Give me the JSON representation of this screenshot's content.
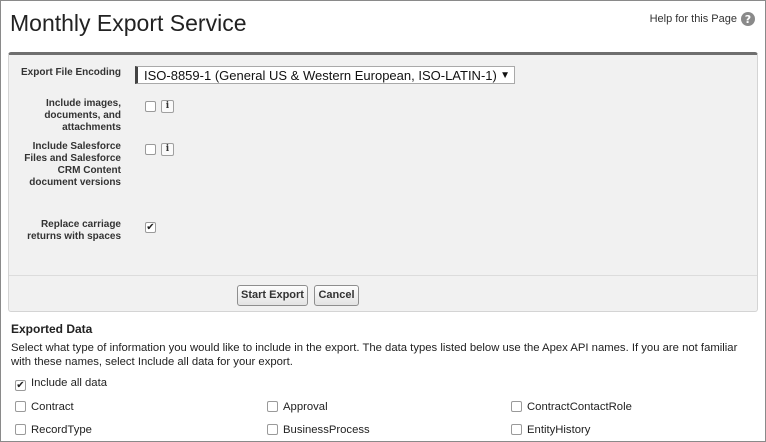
{
  "page": {
    "title": "Monthly Export Service",
    "help_label": "Help for this Page",
    "help_icon": "?"
  },
  "form": {
    "encoding_label": "Export File Encoding",
    "encoding_value": "ISO-8859-1 (General US & Western European, ISO-LATIN-1)",
    "include_images_label": "Include images, documents, and attachments",
    "include_images_checked": false,
    "include_files_label": "Include Salesforce Files and Salesforce CRM Content document versions",
    "include_files_checked": false,
    "replace_cr_label": "Replace carriage returns with spaces",
    "replace_cr_checked": true,
    "info_glyph": "i"
  },
  "buttons": {
    "start_export": "Start Export",
    "cancel": "Cancel"
  },
  "exported_data": {
    "title": "Exported Data",
    "description": "Select what type of information you would like to include in the export. The data types listed below use the Apex API names. If you are not familiar with these names, select Include all data for your export.",
    "include_all_label": "Include all data",
    "include_all_checked": true,
    "objects": [
      {
        "name": "Contract",
        "checked": false
      },
      {
        "name": "Approval",
        "checked": false
      },
      {
        "name": "ContractContactRole",
        "checked": false
      },
      {
        "name": "RecordType",
        "checked": false
      },
      {
        "name": "BusinessProcess",
        "checked": false
      },
      {
        "name": "EntityHistory",
        "checked": false
      }
    ]
  },
  "colors": {
    "panel_bg": "#f1f1f1",
    "panel_top_border": "#6f6f6f"
  }
}
